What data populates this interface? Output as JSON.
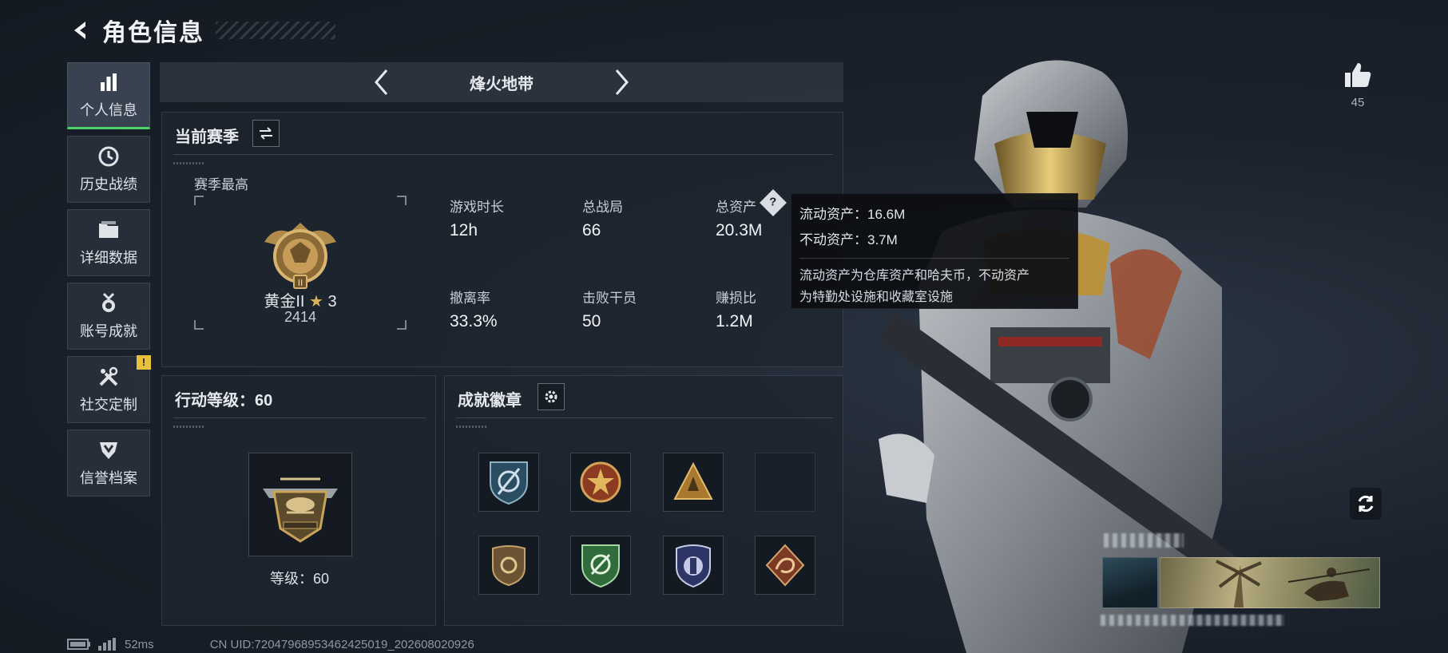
{
  "header": {
    "title": "角色信息"
  },
  "sidebar": {
    "items": [
      {
        "label": "个人信息",
        "icon": "bar-chart-icon",
        "active": true
      },
      {
        "label": "历史战绩",
        "icon": "clock-history-icon"
      },
      {
        "label": "详细数据",
        "icon": "folder-icon"
      },
      {
        "label": "账号成就",
        "icon": "medal-icon"
      },
      {
        "label": "社交定制",
        "icon": "tools-icon",
        "badge": "!"
      },
      {
        "label": "信誉档案",
        "icon": "shield-emblem-icon"
      }
    ]
  },
  "mode": {
    "name": "烽火地带"
  },
  "season": {
    "title": "当前赛季",
    "best_label": "赛季最高",
    "rank_name": "黄金II",
    "rank_stars": "3",
    "rank_score": "2414",
    "stats": [
      {
        "label": "游戏时长",
        "value": "12h"
      },
      {
        "label": "总战局",
        "value": "66"
      },
      {
        "label": "总资产",
        "value": "20.3M"
      },
      {
        "label": "撤离率",
        "value": "33.3%"
      },
      {
        "label": "击败干员",
        "value": "50"
      },
      {
        "label": "赚损比",
        "value": "1.2M"
      }
    ]
  },
  "tooltip": {
    "liquid": "流动资产：16.6M",
    "fixed": "不动资产：3.7M",
    "desc_line1": "流动资产为仓库资产和哈夫币，不动资产",
    "desc_line2": "为特勤处设施和收藏室设施"
  },
  "level": {
    "title": "行动等级：60",
    "caption": "等级：60"
  },
  "badges": {
    "title": "成就徽章"
  },
  "likes": {
    "count": "45"
  },
  "footer": {
    "ping": "52ms",
    "uid": "CN UID:7204796895346242501​9_202608020926"
  },
  "colors": {
    "accent": "#4cd36a",
    "gold": "#c9a35a",
    "badge_yellow": "#e8c23a"
  }
}
